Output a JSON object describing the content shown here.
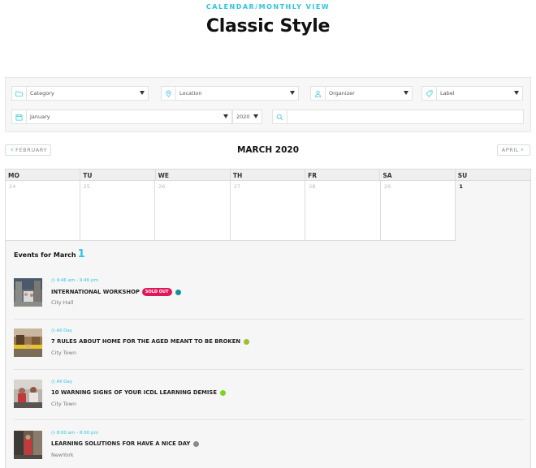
{
  "header": {
    "subtitle": "CALENDAR/MONTHLY VIEW",
    "title": "Classic Style"
  },
  "filters": {
    "category": "Category",
    "location": "Location",
    "organizer": "Organizer",
    "label": "Label",
    "month": "January",
    "year": "2020",
    "search_value": ""
  },
  "nav": {
    "prev": "FEBRUARY",
    "current": "MARCH 2020",
    "next": "APRIL"
  },
  "calendar": {
    "day_names": [
      "MO",
      "TU",
      "WE",
      "TH",
      "FR",
      "SA",
      "SU"
    ],
    "days": [
      "24",
      "25",
      "26",
      "27",
      "28",
      "29",
      "1"
    ]
  },
  "events_heading": {
    "label": "Events for March",
    "day": "1"
  },
  "events": [
    {
      "time": "9:46 am - 9:46 pm",
      "title": "INTERNATIONAL WORKSHOP",
      "badge": "SOLD OUT",
      "location": "City Hall",
      "dot_color": "#17909b"
    },
    {
      "time": "All Day",
      "title": "7 RULES ABOUT HOME FOR THE AGED MEANT TO BE BROKEN",
      "location": "City Town",
      "dot_color": "#9bbf2e"
    },
    {
      "time": "All Day",
      "title": "10 WARNING SIGNS OF YOUR ICDL LEARNING DEMISE",
      "location": "City Town",
      "dot_color": "#7ed321"
    },
    {
      "time": "8:00 am - 8:00 pm",
      "title": "LEARNING SOLUTIONS FOR HAVE A NICE DAY",
      "location": "NewYork",
      "dot_color": "#8a8a8a"
    }
  ],
  "colors": {
    "accent": "#2ec4e0",
    "sold_out": "#e0185b"
  }
}
